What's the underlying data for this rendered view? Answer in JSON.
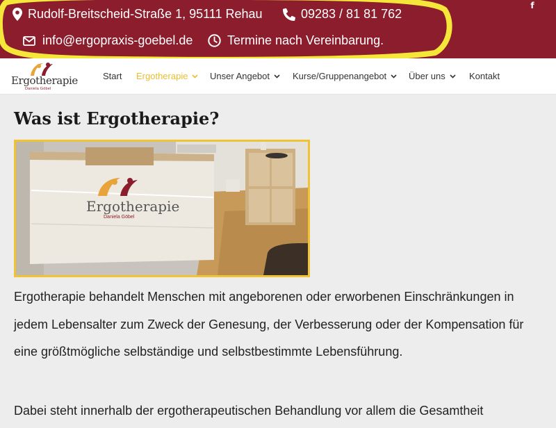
{
  "topbar": {
    "address": "Rudolf-Breitscheid-Straße 1, 95111 Rehau",
    "phone": "09283 / 81 81 762",
    "email": "info@ergopraxis-goebel.de",
    "hours": "Termine nach Vereinbarung.",
    "facebook_glyph": "f",
    "background_color": "#8b1d2c",
    "highlight_color": "#f5e63a"
  },
  "logo": {
    "name": "Ergotherapie",
    "subtitle": "Daniela Göbel"
  },
  "nav": {
    "items": [
      {
        "label": "Start",
        "has_dropdown": false,
        "active": false
      },
      {
        "label": "Ergotherapie",
        "has_dropdown": true,
        "active": true
      },
      {
        "label": "Unser Angebot",
        "has_dropdown": true,
        "active": false
      },
      {
        "label": "Kurse/Gruppenangebot",
        "has_dropdown": true,
        "active": false
      },
      {
        "label": "Über uns",
        "has_dropdown": true,
        "active": false
      },
      {
        "label": "Kontakt",
        "has_dropdown": false,
        "active": false
      }
    ],
    "active_color": "#e9bf2f"
  },
  "content": {
    "title": "Was ist Ergotherapie?",
    "photo_sign_text": "Ergotherapie",
    "photo_sign_subtitle": "Daniela Göbel",
    "paragraph1": "Ergotherapie behandelt Menschen mit angeborenen oder erworbenen Einschränkungen in jedem Lebensalter zum Zweck der Genesung, der Verbesserung oder der Kompensation für eine größtmögliche selbständige und selbstbestimmte Lebensführung.",
    "paragraph2": "Dabei steht innerhalb der ergotherapeutischen Behandlung vor allem die Gesamtheit"
  }
}
